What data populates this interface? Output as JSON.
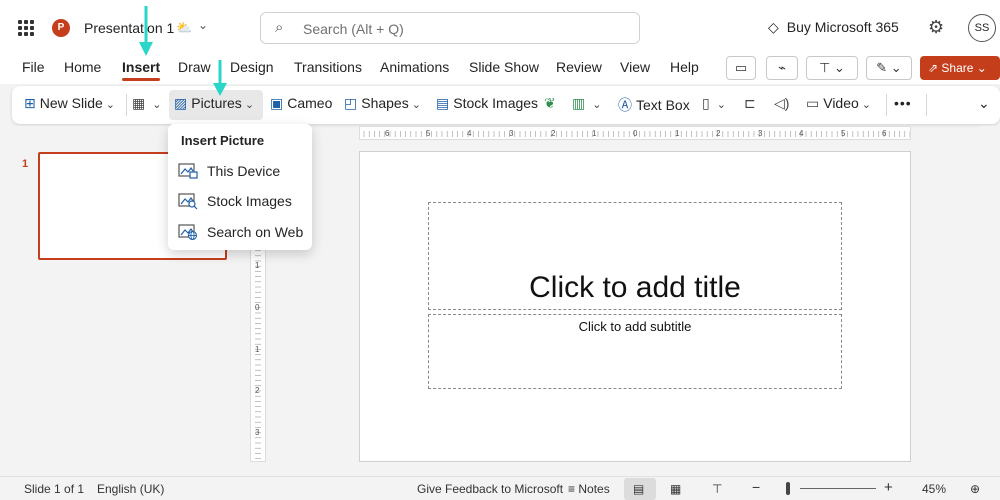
{
  "titlebar": {
    "doc_title": "Presentation 1",
    "search_placeholder": "Search (Alt + Q)",
    "buy_label": "Buy Microsoft 365",
    "avatar_initials": "SS",
    "app_logo_letter": "P"
  },
  "tabs": [
    "File",
    "Home",
    "Insert",
    "Draw",
    "Design",
    "Transitions",
    "Animations",
    "Slide Show",
    "Review",
    "View",
    "Help"
  ],
  "active_tab": "Insert",
  "share_label": "Share",
  "ribbon": {
    "new_slide": "New Slide",
    "pictures": "Pictures",
    "cameo": "Cameo",
    "shapes": "Shapes",
    "stock_images": "Stock Images",
    "text_box": "Text Box",
    "video": "Video",
    "more": "•••"
  },
  "pictures_menu": {
    "heading": "Insert Picture",
    "items": [
      "This Device",
      "Stock Images",
      "Search on Web"
    ]
  },
  "thumbnails": {
    "slide_number": "1"
  },
  "slide": {
    "title_placeholder": "Click to add title",
    "subtitle_placeholder": "Click to add subtitle"
  },
  "ruler": {
    "h_labels": [
      "6",
      "5",
      "4",
      "3",
      "2",
      "1",
      "0",
      "1",
      "2",
      "3",
      "4",
      "5",
      "6"
    ],
    "v_labels": [
      "1",
      "0",
      "1",
      "2",
      "3"
    ]
  },
  "statusbar": {
    "slide_info": "Slide 1 of 1",
    "language": "English (UK)",
    "feedback": "Give Feedback to Microsoft",
    "notes": "Notes",
    "zoom_minus": "−",
    "zoom_plus": "+",
    "zoom_level": "45%"
  },
  "colors": {
    "accent": "#c43e1c",
    "annotation_arrow": "#2ad6c8",
    "icon_blue": "#1f5fa8"
  }
}
